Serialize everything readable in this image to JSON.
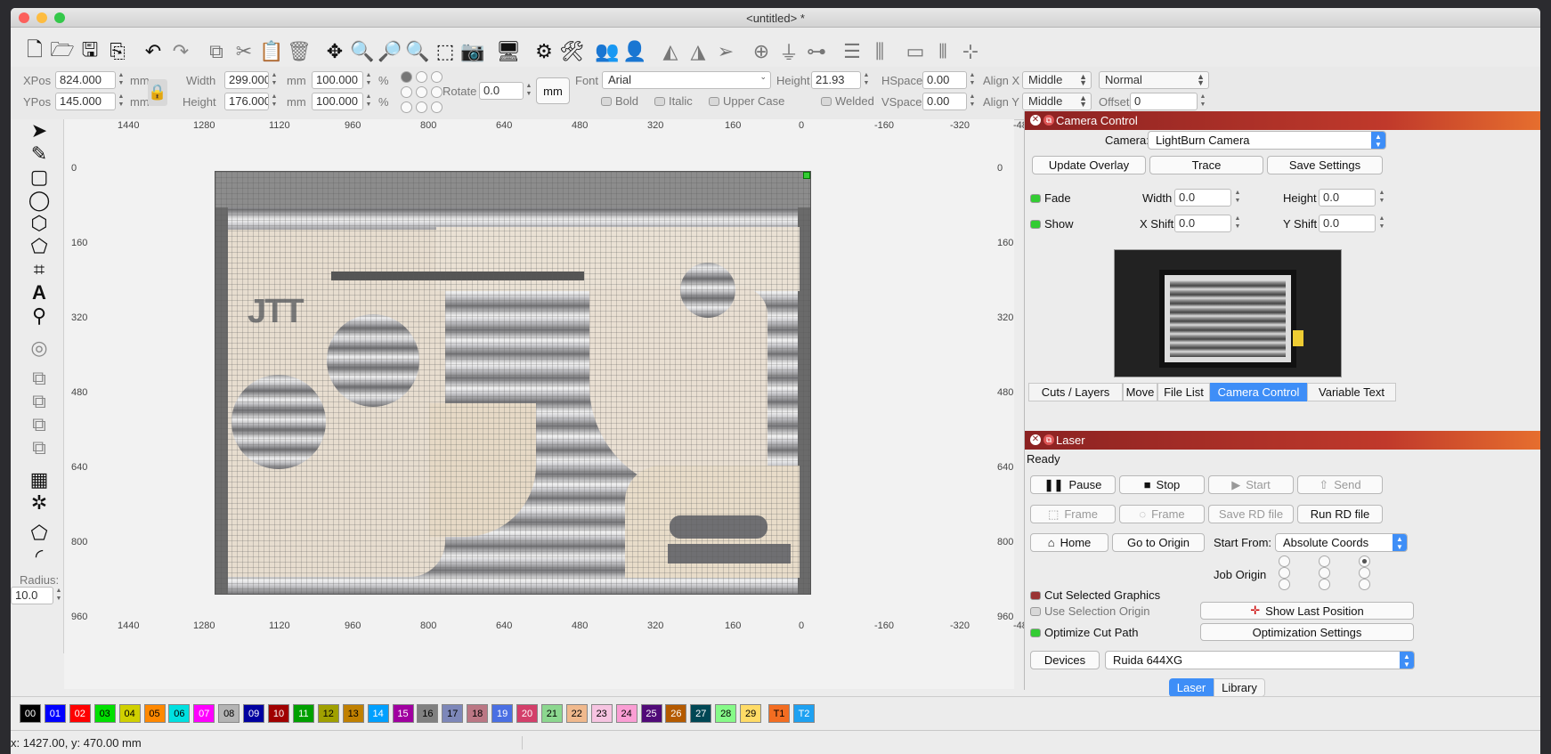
{
  "window": {
    "title": "<untitled> *"
  },
  "properties": {
    "xpos_label": "XPos",
    "xpos": "824.000",
    "ypos_label": "YPos",
    "ypos": "145.000",
    "unit_mm": "mm",
    "width_label": "Width",
    "width": "299.000",
    "height_label": "Height",
    "height": "176.000",
    "width_pct": "100.000",
    "height_pct": "100.000",
    "pct": "%",
    "rotate_label": "Rotate",
    "rotate": "0.0",
    "mm_button": "mm",
    "font_label": "Font",
    "font": "Arial",
    "text_height_label": "Height",
    "text_height": "21.93",
    "hspace_label": "HSpace",
    "hspace": "0.00",
    "vspace_label": "VSpace",
    "vspace": "0.00",
    "alignx_label": "Align X",
    "alignx": "Middle",
    "aligny_label": "Align Y",
    "aligny": "Middle",
    "style": "Normal",
    "offset_label": "Offset",
    "offset": "0",
    "bold": "Bold",
    "italic": "Italic",
    "upper_case": "Upper Case",
    "welded": "Welded"
  },
  "tools": {
    "radius_label": "Radius:",
    "radius": "10.0"
  },
  "rulers": {
    "top": [
      "1440",
      "1280",
      "1120",
      "960",
      "800",
      "640",
      "480",
      "320",
      "160",
      "0",
      "-160",
      "-320",
      "-48"
    ],
    "left": [
      "0",
      "160",
      "320",
      "480",
      "640",
      "800",
      "960"
    ]
  },
  "camera_panel": {
    "title": "Camera Control",
    "camera_label": "Camera:",
    "camera": "LightBurn Camera",
    "update_overlay": "Update Overlay",
    "trace": "Trace",
    "save_settings": "Save Settings",
    "fade": "Fade",
    "show": "Show",
    "width_label": "Width",
    "width": "0.0",
    "height_label": "Height",
    "height": "0.0",
    "xshift_label": "X Shift",
    "xshift": "0.0",
    "yshift_label": "Y Shift",
    "yshift": "0.0"
  },
  "panel_tabs": [
    "Cuts / Layers",
    "Move",
    "File List",
    "Camera Control",
    "Variable Text"
  ],
  "laser_panel": {
    "title": "Laser",
    "status": "Ready",
    "pause": "Pause",
    "stop": "Stop",
    "start": "Start",
    "send": "Send",
    "frame1": "Frame",
    "frame2": "Frame",
    "save_rd": "Save RD file",
    "run_rd": "Run RD file",
    "home": "Home",
    "go_origin": "Go to Origin",
    "start_from_label": "Start From:",
    "start_from": "Absolute Coords",
    "job_origin": "Job Origin",
    "cut_selected": "Cut Selected Graphics",
    "use_selection_origin": "Use Selection Origin",
    "optimize_cut_path": "Optimize Cut Path",
    "show_last_position": "Show Last Position",
    "optimization_settings": "Optimization Settings",
    "devices": "Devices",
    "device": "Ruida 644XG"
  },
  "bottom_tabs": [
    "Laser",
    "Library"
  ],
  "palette": [
    {
      "n": "00",
      "c": "#000000",
      "t": "#ffffff"
    },
    {
      "n": "01",
      "c": "#0000ff",
      "t": "#ffffff"
    },
    {
      "n": "02",
      "c": "#ff0000",
      "t": "#ffffff"
    },
    {
      "n": "03",
      "c": "#00e000",
      "t": "#000000"
    },
    {
      "n": "04",
      "c": "#d0d000",
      "t": "#000000"
    },
    {
      "n": "05",
      "c": "#ff8800",
      "t": "#000000"
    },
    {
      "n": "06",
      "c": "#00e0e0",
      "t": "#000000"
    },
    {
      "n": "07",
      "c": "#ff00ff",
      "t": "#ffffff"
    },
    {
      "n": "08",
      "c": "#b4b4b4",
      "t": "#000000"
    },
    {
      "n": "09",
      "c": "#0000a0",
      "t": "#ffffff"
    },
    {
      "n": "10",
      "c": "#a00000",
      "t": "#ffffff"
    },
    {
      "n": "11",
      "c": "#00a000",
      "t": "#ffffff"
    },
    {
      "n": "12",
      "c": "#a0a000",
      "t": "#000000"
    },
    {
      "n": "13",
      "c": "#c08000",
      "t": "#000000"
    },
    {
      "n": "14",
      "c": "#00a0ff",
      "t": "#ffffff"
    },
    {
      "n": "15",
      "c": "#a000a0",
      "t": "#ffffff"
    },
    {
      "n": "16",
      "c": "#808080",
      "t": "#000000"
    },
    {
      "n": "17",
      "c": "#7d87b9",
      "t": "#000000"
    },
    {
      "n": "18",
      "c": "#bb7784",
      "t": "#000000"
    },
    {
      "n": "19",
      "c": "#4a6fe3",
      "t": "#ffffff"
    },
    {
      "n": "20",
      "c": "#d33f6a",
      "t": "#ffffff"
    },
    {
      "n": "21",
      "c": "#8cd78f",
      "t": "#000000"
    },
    {
      "n": "22",
      "c": "#f0b98d",
      "t": "#000000"
    },
    {
      "n": "23",
      "c": "#f6c4e1",
      "t": "#000000"
    },
    {
      "n": "24",
      "c": "#fa9ed4",
      "t": "#000000"
    },
    {
      "n": "25",
      "c": "#500a78",
      "t": "#ffffff"
    },
    {
      "n": "26",
      "c": "#b45a00",
      "t": "#ffffff"
    },
    {
      "n": "27",
      "c": "#004754",
      "t": "#ffffff"
    },
    {
      "n": "28",
      "c": "#86fa88",
      "t": "#000000"
    },
    {
      "n": "29",
      "c": "#ffdb66",
      "t": "#000000"
    },
    {
      "n": "T1",
      "c": "#f36d21",
      "t": "#000000"
    },
    {
      "n": "T2",
      "c": "#1ea1f1",
      "t": "#ffffff"
    }
  ],
  "status_bar": {
    "coords": "x: 1427.00, y: 470.00 mm"
  },
  "colors": {
    "accent": "#3e8ef7",
    "panel_header": "#c0392b"
  }
}
